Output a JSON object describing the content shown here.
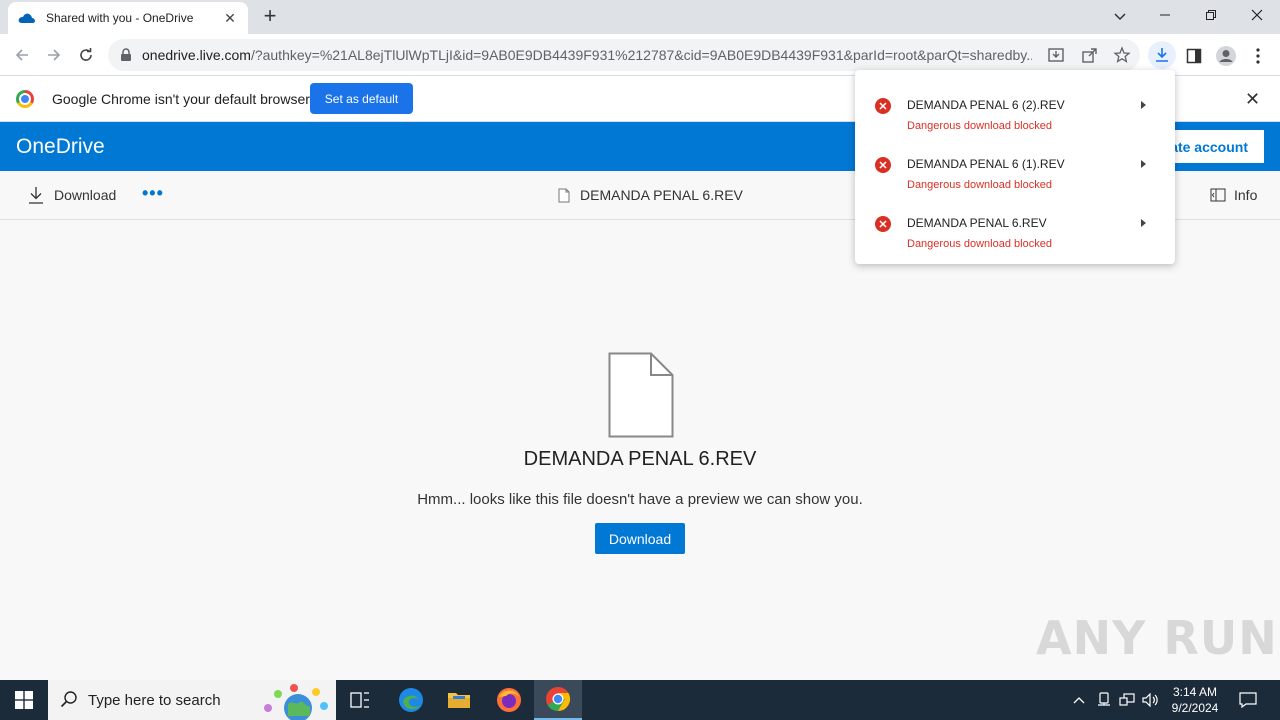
{
  "browser": {
    "tab_title": "Shared with you - OneDrive",
    "url_host": "onedrive.live.com",
    "url_rest": "/?authkey=%21AL8ejTlUlWpTLjI&id=9AB0E9DB4439F931%212787&cid=9AB0E9DB4439F931&parId=root&parQt=sharedby..."
  },
  "infobar": {
    "message": "Google Chrome isn't your default browser",
    "button": "Set as default"
  },
  "onedrive": {
    "brand": "OneDrive",
    "create_account": "ate account",
    "cmd_download": "Download",
    "cmd_more": "•••",
    "file_name": "DEMANDA PENAL 6.REV",
    "cmd_info": "Info"
  },
  "preview": {
    "title": "DEMANDA PENAL 6.REV",
    "message": "Hmm... looks like this file doesn't have a preview we can show you.",
    "download": "Download"
  },
  "downloads": [
    {
      "name": "DEMANDA PENAL 6 (2).REV",
      "status": "Dangerous download blocked"
    },
    {
      "name": "DEMANDA PENAL 6 (1).REV",
      "status": "Dangerous download blocked"
    },
    {
      "name": "DEMANDA PENAL 6.REV",
      "status": "Dangerous download blocked"
    }
  ],
  "watermark": "ANY RUN",
  "taskbar": {
    "search_placeholder": "Type here to search",
    "time": "3:14 AM",
    "date": "9/2/2024"
  },
  "colors": {
    "onedrive_blue": "#0078d4",
    "chrome_blue": "#1a73e8",
    "error_red": "#d93025",
    "taskbar": "#1c2b3a"
  }
}
